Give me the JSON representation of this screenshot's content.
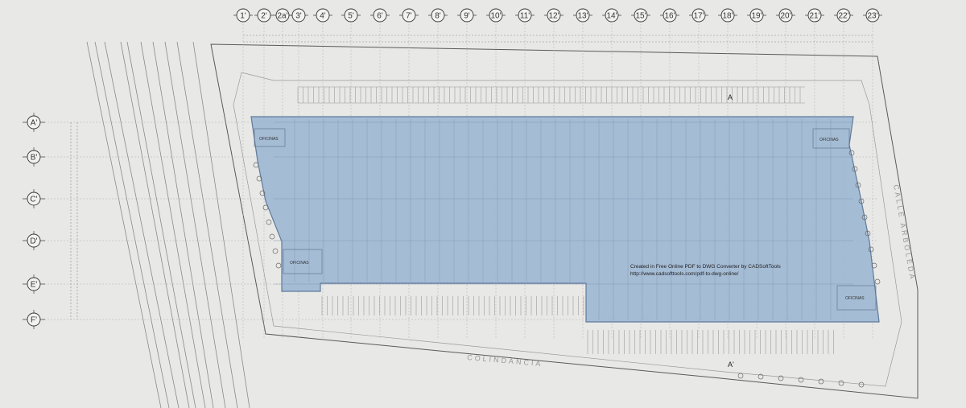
{
  "grid": {
    "columns": [
      "1'",
      "2'",
      "2a'",
      "3'",
      "4'",
      "5'",
      "6'",
      "7'",
      "8'",
      "9'",
      "10'",
      "11'",
      "12'",
      "13'",
      "14'",
      "15'",
      "16'",
      "17'",
      "18'",
      "19'",
      "20'",
      "21'",
      "22'",
      "23'"
    ],
    "rows": [
      "A'",
      "B'",
      "C'",
      "D'",
      "E'",
      "F'"
    ]
  },
  "rooms": [
    "OFICINAS",
    "OFICINAS",
    "OFICINAS",
    "OFICINAS"
  ],
  "section_marks": [
    "A",
    "A'"
  ],
  "streets": {
    "bottom": "COLINDANCIA",
    "right": "CALLE ARBOLEDA"
  },
  "watermark": {
    "line1": "Created in Free Online PDF to DWG Converter by CADSoftTools",
    "line2": "http://www.cadsofttools.com/pdf-to-dwg-online/"
  },
  "colors": {
    "background": "#e8e8e6",
    "building_fill": "#9db7d3",
    "building_stroke": "#5f7a9a",
    "linework": "#6e6e6e",
    "light_linework": "#b5b5b5"
  }
}
